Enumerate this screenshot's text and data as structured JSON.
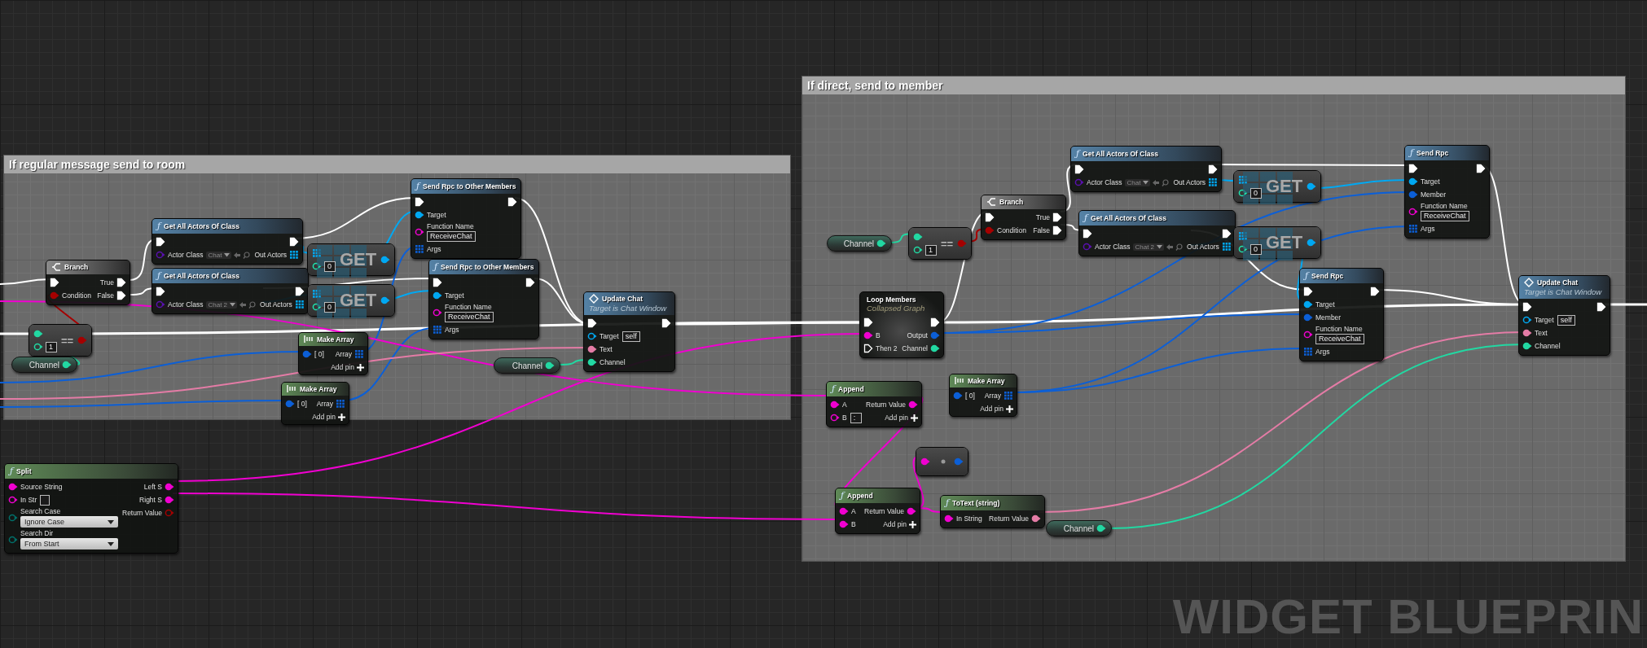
{
  "comments": [
    {
      "title": "If regular message send to room"
    },
    {
      "title": "If direct, send to member"
    }
  ],
  "nodes": [
    {
      "kind": "branch",
      "title": "Branch",
      "inputs": [
        {
          "kind": "exec",
          "linked": true
        },
        {
          "label": "Condition",
          "kind": "bool",
          "linked": true
        }
      ],
      "outputs": [
        {
          "label": "True",
          "kind": "exec",
          "linked": true
        },
        {
          "label": "False",
          "kind": "exec",
          "linked": true
        }
      ]
    },
    {
      "kind": "call",
      "icon": "ƒ",
      "title": "Get All Actors Of Class",
      "inputs": [
        {
          "kind": "exec",
          "linked": true
        },
        {
          "label": "Actor Class",
          "kind": "class",
          "linked": false,
          "dropdown": "Chat"
        }
      ],
      "outputs": [
        {
          "kind": "exec",
          "linked": true
        },
        {
          "label": "Out Actors",
          "kind": "object_array",
          "linked": true
        }
      ]
    },
    {
      "kind": "call",
      "icon": "ƒ",
      "title": "Get All Actors Of Class",
      "inputs": [
        {
          "kind": "exec",
          "linked": true
        },
        {
          "label": "Actor Class",
          "kind": "class",
          "linked": false,
          "dropdown": "Chat 2"
        }
      ],
      "outputs": [
        {
          "kind": "exec",
          "linked": true
        },
        {
          "label": "Out Actors",
          "kind": "object_array",
          "linked": true
        }
      ]
    },
    {
      "kind": "array_get",
      "symbol": "GET",
      "inputs": [
        {
          "kind": "object_array",
          "linked": true
        },
        {
          "kind": "int",
          "linked": false,
          "value": "0"
        }
      ],
      "outputs": [
        {
          "kind": "object",
          "linked": true
        }
      ]
    },
    {
      "kind": "array_get",
      "symbol": "GET",
      "inputs": [
        {
          "kind": "object_array",
          "linked": true
        },
        {
          "kind": "int",
          "linked": false,
          "value": "0"
        }
      ],
      "outputs": [
        {
          "kind": "object",
          "linked": true
        }
      ]
    },
    {
      "kind": "call",
      "icon": "ƒ",
      "title": "Send Rpc to Other Members",
      "inputs": [
        {
          "kind": "exec",
          "linked": true
        },
        {
          "label": "Target",
          "kind": "object",
          "linked": true
        },
        {
          "label": "Function Name",
          "kind": "string",
          "linked": false,
          "value": "ReceiveChat"
        },
        {
          "label": "Args",
          "kind": "member_array",
          "linked": true
        }
      ],
      "outputs": [
        {
          "kind": "exec",
          "linked": true
        }
      ]
    },
    {
      "kind": "call",
      "icon": "ƒ",
      "title": "Send Rpc to Other Members",
      "inputs": [
        {
          "kind": "exec",
          "linked": true
        },
        {
          "label": "Target",
          "kind": "object",
          "linked": true
        },
        {
          "label": "Function Name",
          "kind": "string",
          "linked": false,
          "value": "ReceiveChat"
        },
        {
          "label": "Args",
          "kind": "member_array",
          "linked": true
        }
      ],
      "outputs": [
        {
          "kind": "exec",
          "linked": true
        }
      ]
    },
    {
      "kind": "compare",
      "symbol": "==",
      "inputs": [
        {
          "kind": "channel",
          "linked": true
        },
        {
          "kind": "channel",
          "linked": false,
          "value": "1"
        }
      ],
      "outputs": [
        {
          "kind": "bool",
          "linked": true
        }
      ]
    },
    {
      "kind": "getter",
      "outputs": [
        {
          "label": "Channel",
          "kind": "channel",
          "linked": true
        }
      ]
    },
    {
      "kind": "make_array",
      "title": "Make Array",
      "inputs": [
        {
          "label": "[ 0]",
          "kind": "member",
          "linked": true
        }
      ],
      "outputs": [
        {
          "label": "Array",
          "kind": "member_array",
          "linked": true
        }
      ],
      "add_pin": "Add pin"
    },
    {
      "kind": "make_array",
      "title": "Make Array",
      "inputs": [
        {
          "label": "[ 0]",
          "kind": "member",
          "linked": true
        }
      ],
      "outputs": [
        {
          "label": "Array",
          "kind": "member_array",
          "linked": true
        }
      ],
      "add_pin": "Add pin"
    },
    {
      "kind": "message",
      "title": "Update Chat",
      "subtitle": "Target is Chat Window",
      "inputs": [
        {
          "kind": "exec",
          "linked": true
        },
        {
          "label": "Target",
          "kind": "object",
          "linked": false,
          "value": "self"
        },
        {
          "label": "Text",
          "kind": "text",
          "linked": true
        },
        {
          "label": "Channel",
          "kind": "channel",
          "linked": true
        }
      ],
      "outputs": [
        {
          "kind": "exec",
          "linked": true
        }
      ]
    },
    {
      "kind": "getter",
      "outputs": [
        {
          "label": "Channel",
          "kind": "channel",
          "linked": true
        }
      ]
    },
    {
      "kind": "pure",
      "icon": "ƒ",
      "title": "Split",
      "inputs": [
        {
          "label": "Source String",
          "kind": "string",
          "linked": true
        },
        {
          "label": "In Str",
          "kind": "string",
          "linked": false,
          "editable": true
        },
        {
          "label": "Search Case",
          "kind": "enum",
          "linked": false,
          "dropdown": "Ignore Case"
        },
        {
          "label": "Search Dir",
          "kind": "enum",
          "linked": false,
          "dropdown": "From Start"
        }
      ],
      "outputs": [
        {
          "label": "Left S",
          "kind": "string",
          "linked": true
        },
        {
          "label": "Right S",
          "kind": "string",
          "linked": true
        },
        {
          "label": "Return Value",
          "kind": "bool",
          "linked": false
        }
      ]
    },
    {
      "kind": "getter",
      "outputs": [
        {
          "label": "Channel",
          "kind": "channel",
          "linked": true
        }
      ]
    },
    {
      "kind": "compare",
      "symbol": "==",
      "inputs": [
        {
          "kind": "channel",
          "linked": true
        },
        {
          "kind": "channel",
          "linked": false,
          "value": "1"
        }
      ],
      "outputs": [
        {
          "kind": "bool",
          "linked": true
        }
      ]
    },
    {
      "kind": "branch",
      "title": "Branch",
      "inputs": [
        {
          "kind": "exec",
          "linked": true
        },
        {
          "label": "Condition",
          "kind": "bool",
          "linked": true
        }
      ],
      "outputs": [
        {
          "label": "True",
          "kind": "exec",
          "linked": true
        },
        {
          "label": "False",
          "kind": "exec",
          "linked": true
        }
      ]
    },
    {
      "kind": "call",
      "icon": "ƒ",
      "title": "Get All Actors Of Class",
      "inputs": [
        {
          "kind": "exec",
          "linked": true
        },
        {
          "label": "Actor Class",
          "kind": "class",
          "linked": false,
          "dropdown": "Chat"
        }
      ],
      "outputs": [
        {
          "kind": "exec",
          "linked": true
        },
        {
          "label": "Out Actors",
          "kind": "object_array",
          "linked": true
        }
      ]
    },
    {
      "kind": "call",
      "icon": "ƒ",
      "title": "Get All Actors Of Class",
      "inputs": [
        {
          "kind": "exec",
          "linked": true
        },
        {
          "label": "Actor Class",
          "kind": "class",
          "linked": false,
          "dropdown": "Chat 2"
        }
      ],
      "outputs": [
        {
          "kind": "exec",
          "linked": true
        },
        {
          "label": "Out Actors",
          "kind": "object_array",
          "linked": true
        }
      ]
    },
    {
      "kind": "array_get",
      "symbol": "GET",
      "inputs": [
        {
          "kind": "object_array",
          "linked": true
        },
        {
          "kind": "int",
          "linked": false,
          "value": "0"
        }
      ],
      "outputs": [
        {
          "kind": "object",
          "linked": true
        }
      ]
    },
    {
      "kind": "array_get",
      "symbol": "GET",
      "inputs": [
        {
          "kind": "object_array",
          "linked": true
        },
        {
          "kind": "int",
          "linked": false,
          "value": "0"
        }
      ],
      "outputs": [
        {
          "kind": "object",
          "linked": true
        }
      ]
    },
    {
      "kind": "call",
      "icon": "ƒ",
      "title": "Send Rpc",
      "inputs": [
        {
          "kind": "exec",
          "linked": true
        },
        {
          "label": "Target",
          "kind": "object",
          "linked": true
        },
        {
          "label": "Member",
          "kind": "member",
          "linked": true
        },
        {
          "label": "Function Name",
          "kind": "string",
          "linked": false,
          "value": "ReceiveChat"
        },
        {
          "label": "Args",
          "kind": "member_array",
          "linked": true
        }
      ],
      "outputs": [
        {
          "kind": "exec",
          "linked": true
        }
      ]
    },
    {
      "kind": "collapsed",
      "title": "Loop Members",
      "subtitle": "Collapsed Graph",
      "inputs": [
        {
          "kind": "exec",
          "linked": true
        },
        {
          "label": "B",
          "kind": "string",
          "linked": true
        },
        {
          "label": "Then 2",
          "kind": "exec",
          "linked": false
        }
      ],
      "outputs": [
        {
          "kind": "exec",
          "linked": true
        },
        {
          "label": "Output",
          "kind": "member",
          "linked": true
        },
        {
          "label": "Channel",
          "kind": "channel",
          "linked": true
        }
      ]
    },
    {
      "kind": "call",
      "icon": "ƒ",
      "title": "Send Rpc",
      "inputs": [
        {
          "kind": "exec",
          "linked": true
        },
        {
          "label": "Target",
          "kind": "object",
          "linked": true
        },
        {
          "label": "Member",
          "kind": "member",
          "linked": true
        },
        {
          "label": "Function Name",
          "kind": "string",
          "linked": false,
          "value": "ReceiveChat"
        },
        {
          "label": "Args",
          "kind": "member_array",
          "linked": true
        }
      ],
      "outputs": [
        {
          "kind": "exec",
          "linked": true
        }
      ]
    },
    {
      "kind": "message",
      "title": "Update Chat",
      "subtitle": "Target is Chat Window",
      "inputs": [
        {
          "kind": "exec",
          "linked": true
        },
        {
          "label": "Target",
          "kind": "object",
          "linked": false,
          "value": "self"
        },
        {
          "label": "Text",
          "kind": "text",
          "linked": true
        },
        {
          "label": "Channel",
          "kind": "channel",
          "linked": true
        }
      ],
      "outputs": [
        {
          "kind": "exec",
          "linked": true
        }
      ]
    },
    {
      "kind": "pure",
      "icon": "ƒ",
      "title": "Append",
      "inputs": [
        {
          "label": "A",
          "kind": "string",
          "linked": true
        },
        {
          "label": "B",
          "kind": "string",
          "linked": false,
          "value": ":"
        }
      ],
      "outputs": [
        {
          "label": "Return Value",
          "kind": "string",
          "linked": true
        }
      ],
      "add_pin": "Add pin"
    },
    {
      "kind": "make_array",
      "title": "Make Array",
      "inputs": [
        {
          "label": "[ 0]",
          "kind": "member",
          "linked": true
        }
      ],
      "outputs": [
        {
          "label": "Array",
          "kind": "member_array",
          "linked": true
        }
      ],
      "add_pin": "Add pin"
    },
    {
      "kind": "conversion",
      "inputs": [
        {
          "kind": "string",
          "linked": true
        }
      ],
      "outputs": [
        {
          "kind": "member",
          "linked": true
        }
      ]
    },
    {
      "kind": "pure",
      "icon": "ƒ",
      "title": "Append",
      "inputs": [
        {
          "label": "A",
          "kind": "string",
          "linked": true
        },
        {
          "label": "B",
          "kind": "string",
          "linked": true
        }
      ],
      "outputs": [
        {
          "label": "Return Value",
          "kind": "string",
          "linked": true
        }
      ],
      "add_pin": "Add pin"
    },
    {
      "kind": "pure",
      "icon": "ƒ",
      "title": "ToText (string)",
      "inputs": [
        {
          "label": "In String",
          "kind": "string",
          "linked": true
        }
      ],
      "outputs": [
        {
          "label": "Return Value",
          "kind": "text",
          "linked": true
        }
      ]
    },
    {
      "kind": "getter",
      "outputs": [
        {
          "label": "Channel",
          "kind": "channel",
          "linked": true
        }
      ]
    }
  ],
  "corner_label": "WIDGET BLUEPRIN"
}
